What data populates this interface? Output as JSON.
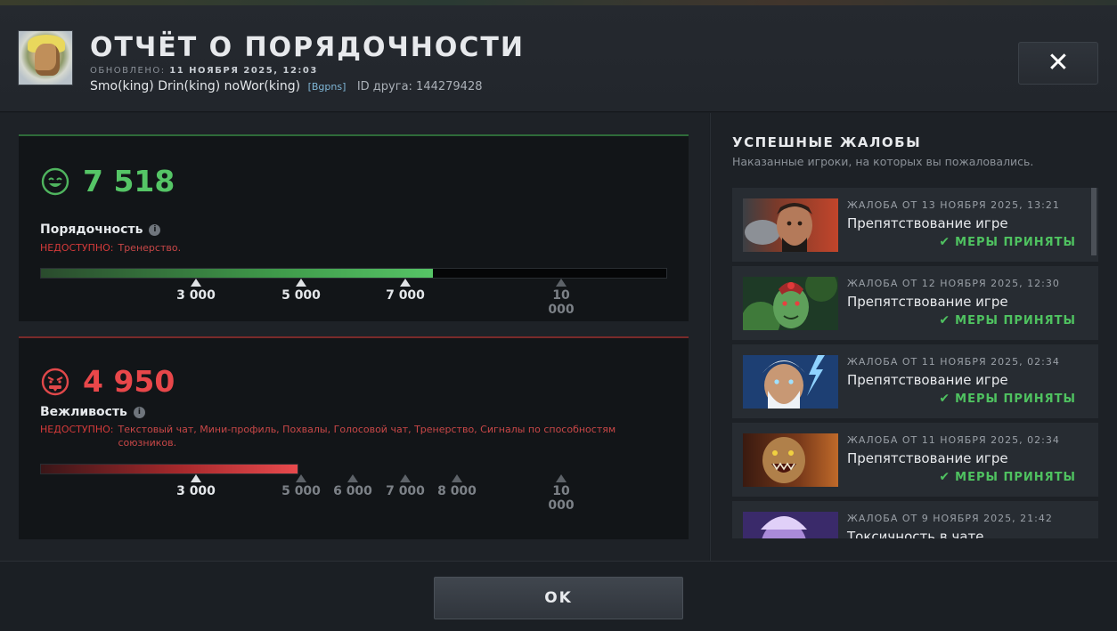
{
  "header": {
    "title": "ОТЧЁТ О ПОРЯДОЧНОСТИ",
    "updated_label": "ОБНОВЛЕНО:",
    "updated_value": "11 НОЯБРЯ 2025, 12:03",
    "player_name": "Smo(king) Drin(king) noWor(king)",
    "player_tag": "[Bgpns]",
    "friend_id": "ID друга: 144279428",
    "close_label": "✕"
  },
  "conduct": {
    "value": "7 518",
    "label": "Порядочность",
    "unavailable_key": "НЕДОСТУПНО:",
    "unavailable_value": "Тренерство.",
    "fill_fraction": 0.627,
    "ticks": [
      {
        "label": "3 000",
        "active": true
      },
      {
        "label": "5 000",
        "active": true
      },
      {
        "label": "7 000",
        "active": true
      },
      {
        "label": "10 000",
        "active": false
      }
    ],
    "color": "#55c566"
  },
  "behavior": {
    "value": "4 950",
    "label": "Вежливость",
    "unavailable_key": "НЕДОСТУПНО:",
    "unavailable_value": "Текстовый чат, Мини-профиль, Похвалы, Голосовой чат, Тренерство, Сигналы по способностям союзников.",
    "fill_fraction": 0.412,
    "ticks": [
      {
        "label": "3 000",
        "active": true
      },
      {
        "label": "5 000",
        "active": false
      },
      {
        "label": "6 000",
        "active": false
      },
      {
        "label": "7 000",
        "active": false
      },
      {
        "label": "8 000",
        "active": false
      },
      {
        "label": "10 000",
        "active": false
      }
    ],
    "color": "#e8474a"
  },
  "reports": {
    "title": "УСПЕШНЫЕ ЖАЛОБЫ",
    "subtitle": "Наказанные игроки, на которых вы пожаловались.",
    "items": [
      {
        "date": "ЖАЛОБА ОТ 13 НОЯБРЯ 2025, 13:21",
        "reason": "Препятствование игре",
        "status": "МЕРЫ ПРИНЯТЫ",
        "hero_icon": "hero-portrait-axe"
      },
      {
        "date": "ЖАЛОБА ОТ 12 НОЯБРЯ 2025, 12:30",
        "reason": "Препятствование игре",
        "status": "МЕРЫ ПРИНЯТЫ",
        "hero_icon": "hero-portrait-medusa"
      },
      {
        "date": "ЖАЛОБА ОТ 11 НОЯБРЯ 2025, 02:34",
        "reason": "Препятствование игре",
        "status": "МЕРЫ ПРИНЯТЫ",
        "hero_icon": "hero-portrait-zeus"
      },
      {
        "date": "ЖАЛОБА ОТ 11 НОЯБРЯ 2025, 02:34",
        "reason": "Препятствование игре",
        "status": "МЕРЫ ПРИНЯТЫ",
        "hero_icon": "hero-portrait-lifestealer"
      },
      {
        "date": "ЖАЛОБА ОТ 9 НОЯБРЯ 2025, 21:42",
        "reason": "Токсичность в чате",
        "status": "",
        "hero_icon": "hero-portrait-void-spirit"
      }
    ]
  },
  "footer": {
    "ok_label": "OK"
  }
}
